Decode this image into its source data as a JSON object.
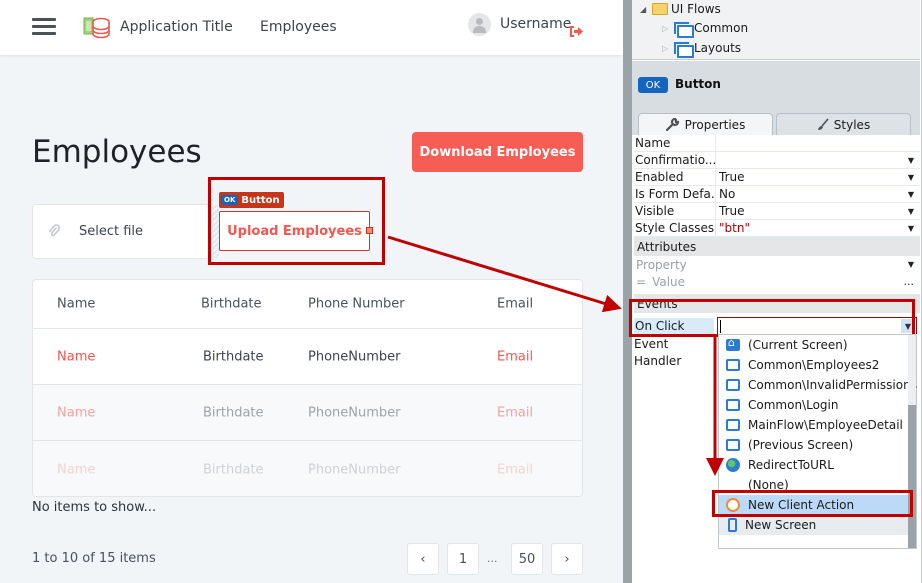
{
  "app": {
    "header": {
      "menu_icon": "hamburger-icon",
      "logo_icon": "database-logo-icon",
      "title": "Application Title",
      "nav_link": "Employees",
      "avatar_icon": "user-avatar-icon",
      "username": "Username",
      "logout_icon": "logout-icon"
    },
    "page_title": "Employees",
    "download_button": "Download Employees",
    "upload": {
      "attach_icon": "paperclip-icon",
      "select_file_label": "Select file",
      "widget_badge_ok": "OK",
      "widget_badge_label": "Button",
      "upload_button": "Upload Employees"
    },
    "table": {
      "columns": [
        "Name",
        "Birthdate",
        "Phone Number",
        "Email"
      ],
      "rows": [
        [
          "Name",
          "Birthdate",
          "PhoneNumber",
          "Email"
        ],
        [
          "Name",
          "Birthdate",
          "PhoneNumber",
          "Email"
        ],
        [
          "Name",
          "Birthdate",
          "PhoneNumber",
          "Email"
        ]
      ]
    },
    "empty_message": "No items to show...",
    "pagination": {
      "summary": "1 to 10 of 15 items",
      "prev": "‹",
      "pages": [
        "1",
        "50"
      ],
      "ellipsis": "...",
      "next": "›"
    }
  },
  "ide": {
    "tree": {
      "root": "UI Flows",
      "children": [
        "Common",
        "Layouts"
      ]
    },
    "widget": {
      "chip": "OK",
      "name": "Button"
    },
    "tabs": [
      {
        "label": "Properties",
        "icon": "wrench-icon",
        "active": true
      },
      {
        "label": "Styles",
        "icon": "brush-icon",
        "active": false
      }
    ],
    "properties": [
      {
        "key": "Name",
        "value": "",
        "dropdown": false
      },
      {
        "key": "Confirmatio...",
        "value": "",
        "dropdown": true
      },
      {
        "key": "Enabled",
        "value": "True",
        "dropdown": true
      },
      {
        "key": "Is Form Defa...",
        "value": "No",
        "dropdown": true
      },
      {
        "key": "Visible",
        "value": "True",
        "dropdown": true
      },
      {
        "key": "Style Classes",
        "value": "\"btn\"",
        "dropdown": true
      }
    ],
    "attributes": {
      "header": "Attributes",
      "property_placeholder": "Property",
      "value_prefix": "=",
      "value_placeholder": "Value",
      "more": "..."
    },
    "events": {
      "header": "Events",
      "on_click_label": "On Click",
      "on_click_value": "",
      "event_label": "Event",
      "handler_label": "Handler"
    },
    "dropdown_options": [
      {
        "label": "(Current Screen)",
        "icon": "home-screen-icon"
      },
      {
        "label": "Common\\Employees2",
        "icon": "screen-icon"
      },
      {
        "label": "Common\\InvalidPermissions",
        "icon": "screen-icon"
      },
      {
        "label": "Common\\Login",
        "icon": "screen-icon"
      },
      {
        "label": "MainFlow\\EmployeeDetail",
        "icon": "screen-icon"
      },
      {
        "label": "(Previous Screen)",
        "icon": "screen-icon"
      },
      {
        "label": "RedirectToURL",
        "icon": "globe-icon"
      },
      {
        "label": "(None)",
        "icon": ""
      },
      {
        "label": "New Client Action",
        "icon": "client-action-icon",
        "selected": true
      },
      {
        "label": "New Screen",
        "icon": "mobile-screen-icon"
      }
    ]
  },
  "annotation_color": "#c00000",
  "accent_color": "#f75d54"
}
